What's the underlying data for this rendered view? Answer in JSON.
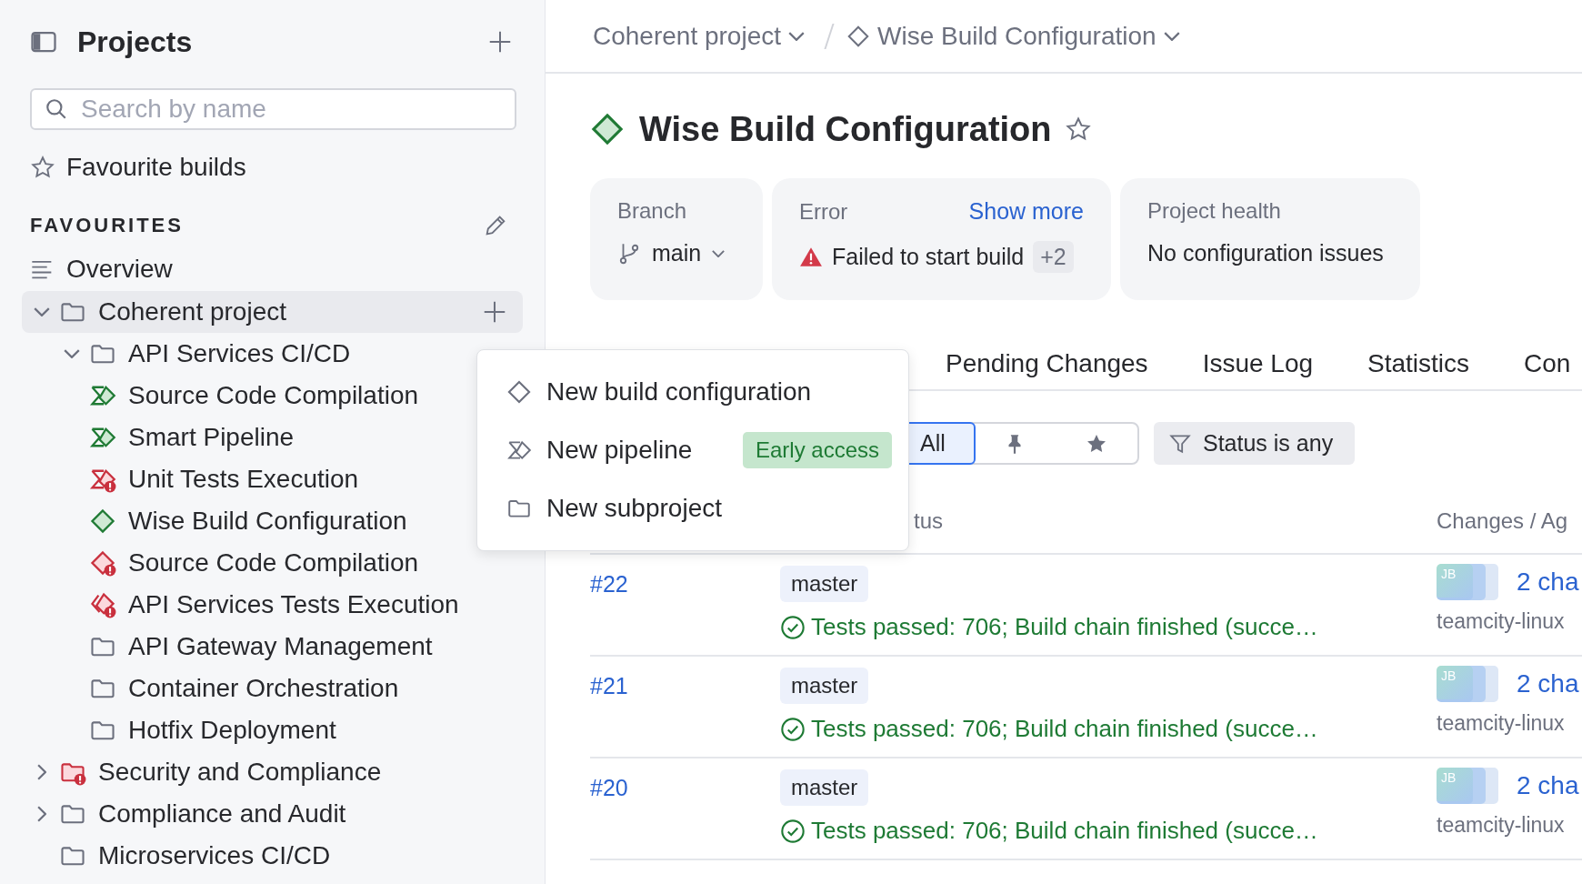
{
  "sidebar": {
    "title": "Projects",
    "search": {
      "placeholder": "Search by name"
    },
    "favourite_builds": "Favourite builds",
    "section_title": "FAVOURITES",
    "overview": "Overview",
    "tree": [
      {
        "label": "Coherent project",
        "kind": "project",
        "expanded": true,
        "selected": true,
        "children": [
          {
            "label": "API Services CI/CD",
            "kind": "project",
            "expanded": true,
            "selected": false
          },
          {
            "label": "Source Code Compilation",
            "kind": "pipeline",
            "selected": false
          },
          {
            "label": "Smart Pipeline",
            "kind": "pipeline",
            "selected": false
          },
          {
            "label": "Unit Tests Execution",
            "kind": "pipeline-failed",
            "selected": false
          },
          {
            "label": "Wise Build Configuration",
            "kind": "build",
            "selected": false
          },
          {
            "label": "Source Code Compilation",
            "kind": "build-failed",
            "selected": false
          },
          {
            "label": "API Services Tests Execution",
            "kind": "composite-failed",
            "selected": false
          },
          {
            "label": "API Gateway Management",
            "kind": "project",
            "selected": false
          },
          {
            "label": "Container Orchestration",
            "kind": "project",
            "selected": false
          },
          {
            "label": "Hotfix Deployment",
            "kind": "project",
            "selected": false
          }
        ]
      },
      {
        "label": "Security and Compliance",
        "kind": "project-failed",
        "expanded": false,
        "selected": false
      },
      {
        "label": "Compliance and Audit",
        "kind": "project",
        "expanded": false,
        "selected": false
      },
      {
        "label": "Microservices CI/CD",
        "kind": "project",
        "selected": false
      }
    ]
  },
  "breadcrumb": [
    {
      "label": "Coherent project",
      "kind": "project"
    },
    {
      "label": "Wise Build Configuration",
      "kind": "build"
    }
  ],
  "header": {
    "title": "Wise Build Configuration",
    "favourite": false
  },
  "cards": {
    "branch": {
      "label": "Branch",
      "value": "main"
    },
    "error": {
      "label": "Error",
      "link": "Show more",
      "message": "Failed to start build",
      "extra": "+2"
    },
    "health": {
      "label": "Project health",
      "value": "No configuration issues"
    }
  },
  "tabs": [
    {
      "label": "Pending Changes",
      "selected": false
    },
    {
      "label": "Issue Log",
      "selected": false
    },
    {
      "label": "Statistics",
      "selected": false
    },
    {
      "label": "Con",
      "selected": false
    }
  ],
  "filters": {
    "segments": [
      {
        "kind": "text",
        "label": "All",
        "selected": true
      },
      {
        "kind": "pin",
        "selected": false
      },
      {
        "kind": "star",
        "selected": false
      }
    ],
    "status_filter": "Status is any"
  },
  "table": {
    "columns": [
      "tus",
      "Changes / Ag"
    ],
    "rows": [
      {
        "number": "#22",
        "branch": "master",
        "status": "Tests passed: 706; Build chain finished (succe…",
        "avatar": "JB",
        "changes": "2 cha",
        "agent": "teamcity-linux"
      },
      {
        "number": "#21",
        "branch": "master",
        "status": "Tests passed: 706; Build chain finished (succe…",
        "avatar": "JB",
        "changes": "2 cha",
        "agent": "teamcity-linux"
      },
      {
        "number": "#20",
        "branch": "master",
        "status": "Tests passed: 706; Build chain finished (succe…",
        "avatar": "JB",
        "changes": "2 cha",
        "agent": "teamcity-linux"
      }
    ]
  },
  "menu": {
    "items": [
      {
        "kind": "build",
        "label": "New build configuration"
      },
      {
        "kind": "pipeline",
        "label": "New pipeline",
        "badge": "Early access"
      },
      {
        "kind": "project",
        "label": "New subproject"
      }
    ]
  }
}
